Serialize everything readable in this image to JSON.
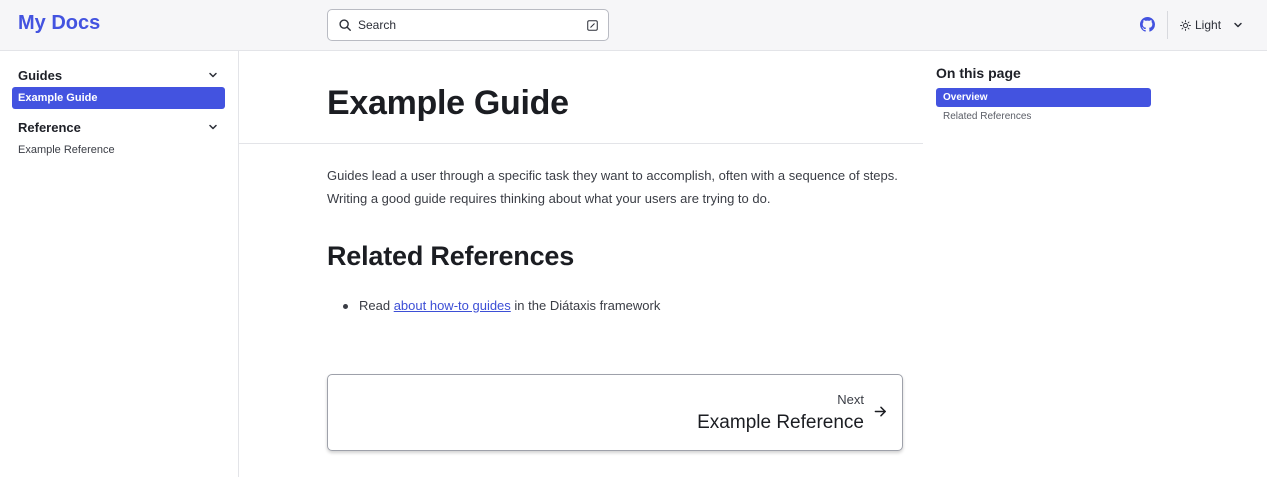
{
  "header": {
    "site_title": "My Docs",
    "search_label": "Search",
    "theme_label": "Light",
    "icons": {
      "search": "search-icon",
      "kbd": "keyboard-shortcut-icon",
      "github": "github-icon",
      "theme": "sun-icon",
      "dropdown": "chevron-down-icon"
    }
  },
  "sidebar": {
    "groups": [
      {
        "title": "Guides",
        "items": [
          {
            "label": "Example Guide",
            "active": true
          }
        ]
      },
      {
        "title": "Reference",
        "items": [
          {
            "label": "Example Reference",
            "active": false
          }
        ]
      }
    ]
  },
  "main": {
    "title": "Example Guide",
    "intro": "Guides lead a user through a specific task they want to accomplish, often with a sequence of steps. Writing a good guide requires thinking about what your users are trying to do.",
    "related_heading": "Related References",
    "bullet": {
      "prefix": "Read ",
      "link_text": "about how-to guides",
      "suffix": " in the Diátaxis framework"
    },
    "next": {
      "label": "Next",
      "title": "Example Reference"
    }
  },
  "toc": {
    "title": "On this page",
    "items": [
      {
        "label": "Overview",
        "active": true
      },
      {
        "label": "Related References",
        "active": false
      }
    ]
  },
  "colors": {
    "accent": "#4353e0",
    "link": "#3d4fd6",
    "header_bg": "#f6f6f8",
    "text": "#23262f"
  }
}
